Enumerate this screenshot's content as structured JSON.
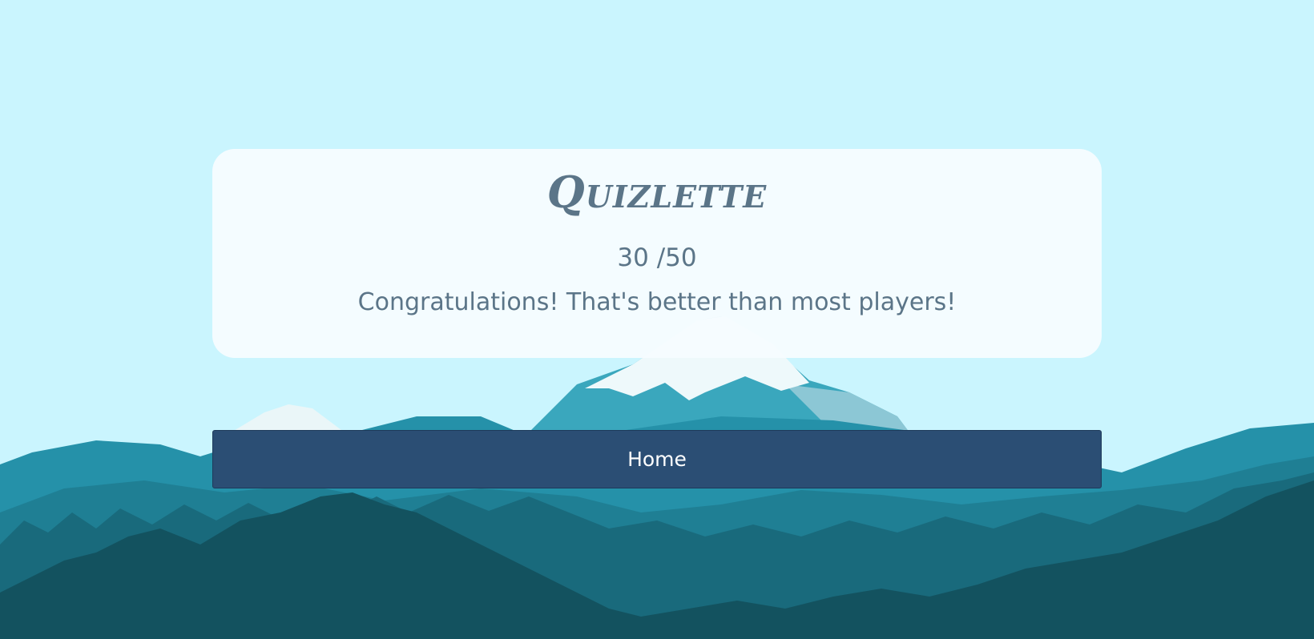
{
  "app": {
    "logo_text": "Quizlette"
  },
  "result": {
    "score": "30 /50",
    "message": "Congratulations! That's better than most players!"
  },
  "actions": {
    "home_label": "Home"
  },
  "colors": {
    "sky": "#caf5fe",
    "card_text": "#5b7588",
    "button_bg": "#2b4e74",
    "button_text": "#ffffff"
  }
}
